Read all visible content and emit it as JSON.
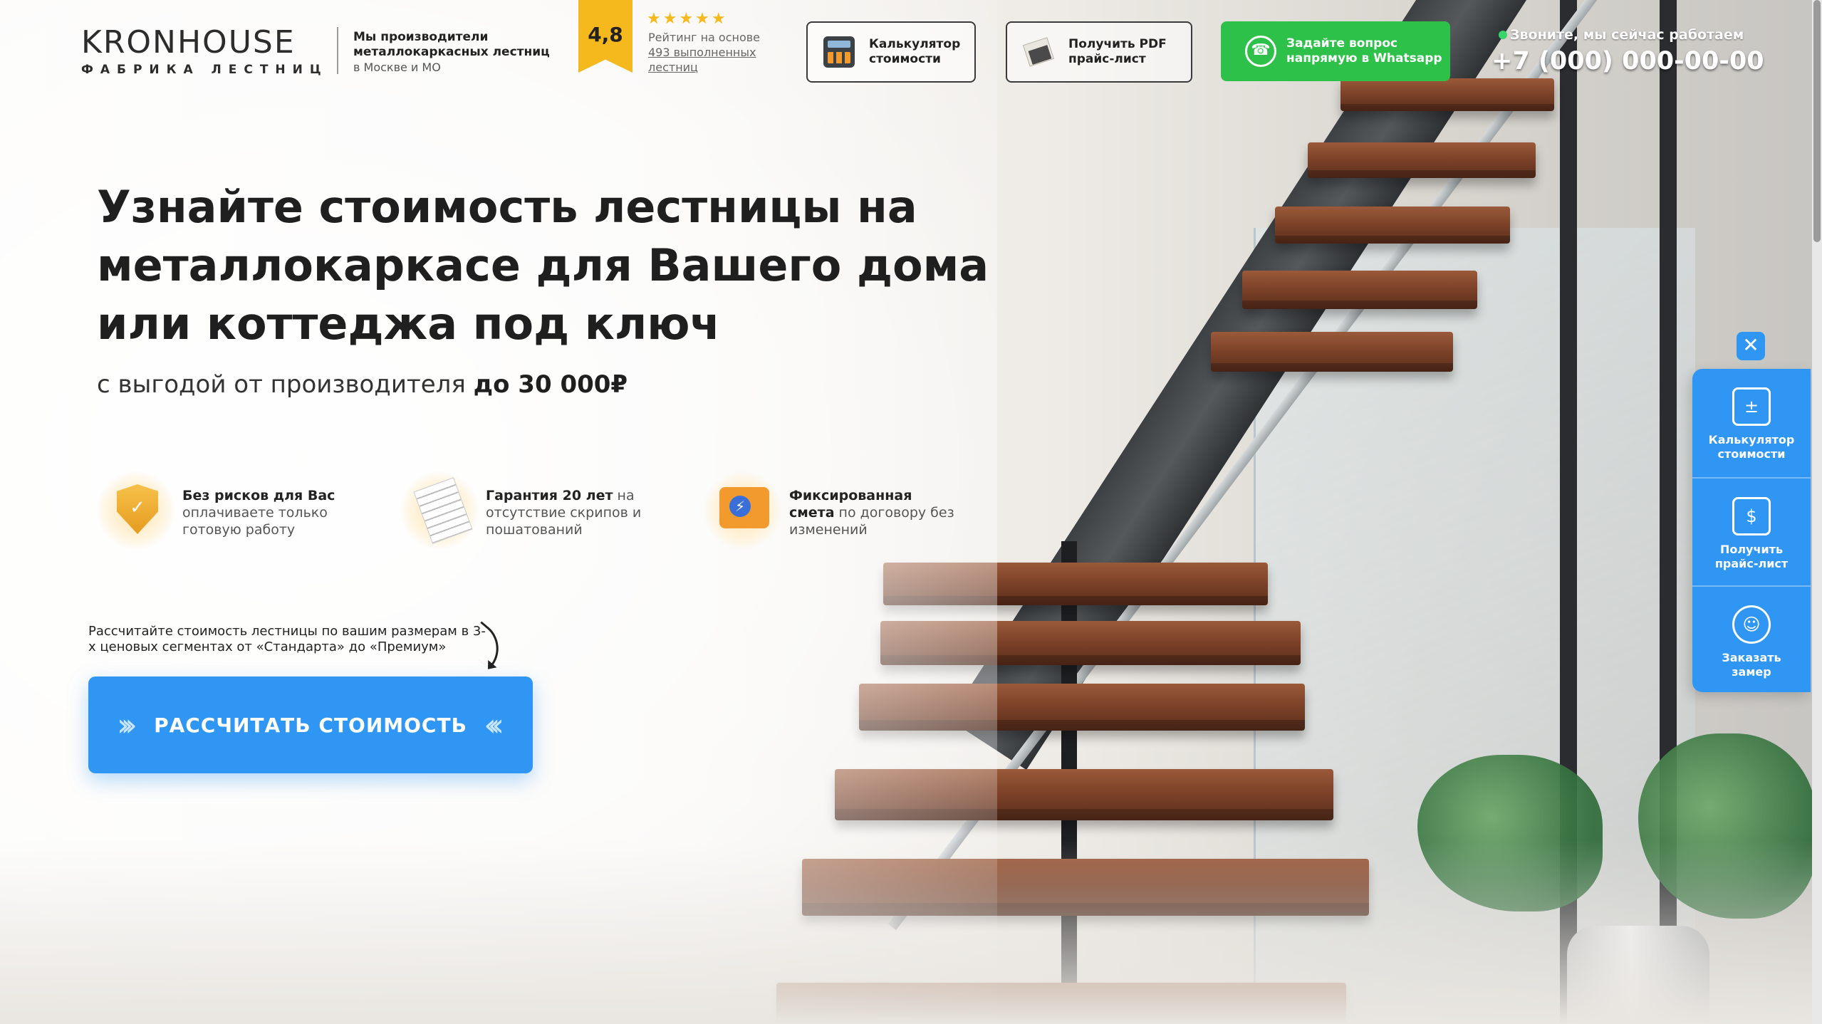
{
  "brand": {
    "name": "KRONHOUSE",
    "subtitle": "ФАБРИКА ЛЕСТНИЦ",
    "tagline_bold": "Мы производители металлокаркасных лестниц",
    "tagline_city": "в Москве и МО"
  },
  "rating": {
    "score": "4,8",
    "stars": "★★★★★",
    "text_prefix": "Рейтинг на основе",
    "text_link": "493 выполненных лестниц"
  },
  "header_buttons": {
    "calculator": "Калькулятор стоимости",
    "pdf": "Получить PDF прайс-лист",
    "whatsapp": "Задайте вопрос напрямую в Whatsapp"
  },
  "contact": {
    "status": "Звоните, мы сейчас работаем",
    "phone": "+7 (000) 000-00-00"
  },
  "hero": {
    "title_bold": "Узнайте стоимость лестницы на металлокаркасе",
    "title_rest": " для Вашего дома или коттеджа под ключ",
    "subtitle_prefix": "с выгодой от производителя ",
    "subtitle_bold": "до 30 000₽"
  },
  "features": [
    {
      "title": "Без рисков для Вас",
      "text": "оплачиваете только готовую работу"
    },
    {
      "title": "Гарантия 20 лет",
      "text": " на отсутствие скрипов и пошатований"
    },
    {
      "title": "Фиксированная смета",
      "text": " по договору без изменений"
    }
  ],
  "calc_note": "Рассчитайте стоимость лестницы по вашим размерам в 3-х ценовых сегментах от «Стандарта» до «Премиум»",
  "cta": {
    "label": "РАССЧИТАТЬ СТОИМОСТЬ",
    "chev_left": "›››",
    "chev_right": "‹‹‹"
  },
  "side_panel": {
    "close": "✕",
    "items": [
      {
        "label": "Калькулятор стоимости",
        "icon": "calculator-icon"
      },
      {
        "label": "Получить прайс-лист",
        "icon": "price-list-icon"
      },
      {
        "label": "Заказать замер",
        "icon": "measurer-icon"
      }
    ]
  },
  "colors": {
    "accent_blue": "#2f96f3",
    "whatsapp_green": "#2ec14a",
    "rating_yellow": "#f5b91e"
  }
}
